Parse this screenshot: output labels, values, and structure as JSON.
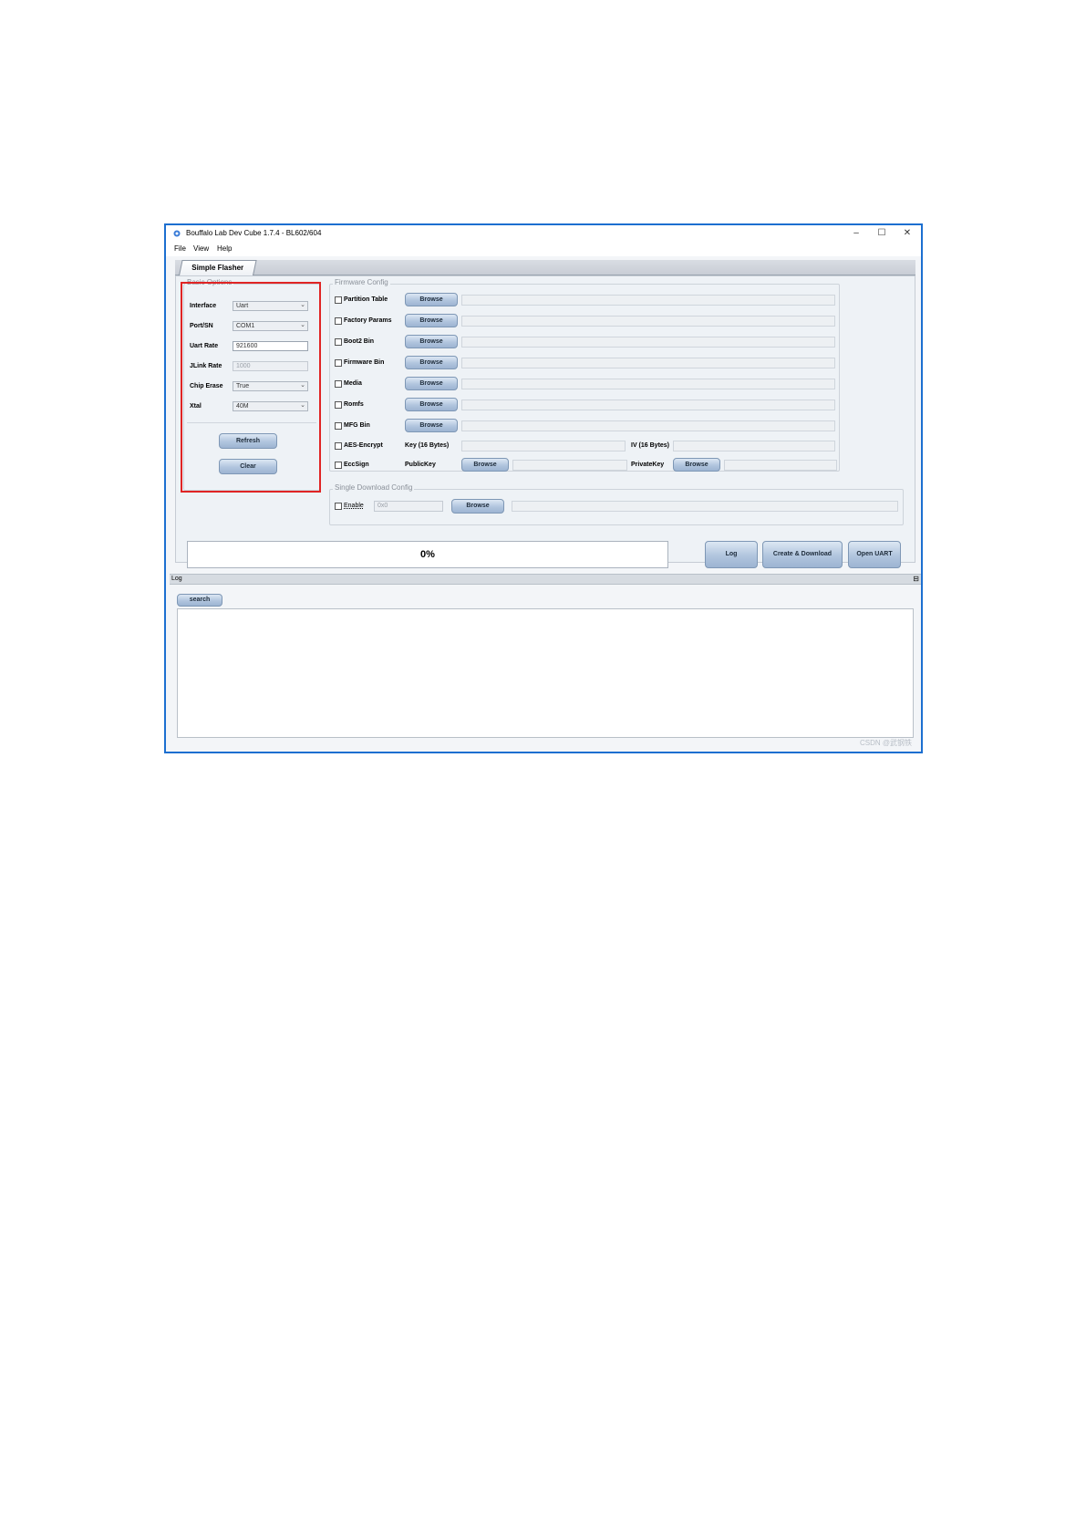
{
  "window": {
    "title": "Bouffalo Lab Dev Cube 1.7.4 - BL602/604",
    "controls": {
      "minimize": "–",
      "maximize": "☐",
      "close": "✕"
    }
  },
  "menu": {
    "file": "File",
    "view": "View",
    "help": "Help"
  },
  "tab": {
    "label": "Simple Flasher"
  },
  "basic_options": {
    "title": "Basic Options",
    "interface": {
      "label": "Interface",
      "value": "Uart"
    },
    "port": {
      "label": "Port/SN",
      "value": "COM1"
    },
    "uart_rate": {
      "label": "Uart Rate",
      "value": "921600"
    },
    "jlink_rate": {
      "label": "JLink Rate",
      "value": "1000"
    },
    "chip_erase": {
      "label": "Chip Erase",
      "value": "True"
    },
    "xtal": {
      "label": "Xtal",
      "value": "40M"
    },
    "refresh_label": "Refresh",
    "clear_label": "Clear"
  },
  "firmware_config": {
    "title": "Firmware Config",
    "browse_label": "Browse",
    "items": [
      {
        "label": "Partition Table"
      },
      {
        "label": "Factory Params"
      },
      {
        "label": "Boot2 Bin"
      },
      {
        "label": "Firmware Bin"
      },
      {
        "label": "Media"
      },
      {
        "label": "Romfs"
      },
      {
        "label": "MFG Bin"
      }
    ],
    "aes": {
      "label": "AES-Encrypt",
      "key_label": "Key (16 Bytes)",
      "iv_label": "IV (16 Bytes)"
    },
    "ecc": {
      "label": "EccSign",
      "public_label": "PublicKey",
      "private_label": "PrivateKey"
    }
  },
  "single_download": {
    "title": "Single Download Config",
    "enable_label": "Enable",
    "address_placeholder": "0x0",
    "browse_label": "Browse"
  },
  "progress": {
    "text": "0%",
    "value": 0
  },
  "actions": {
    "log_label": "Log",
    "create_label": "Create & Download",
    "open_uart_label": "Open UART"
  },
  "log": {
    "title": "Log",
    "search_label": "search"
  },
  "watermark": "CSDN @武钢铁"
}
